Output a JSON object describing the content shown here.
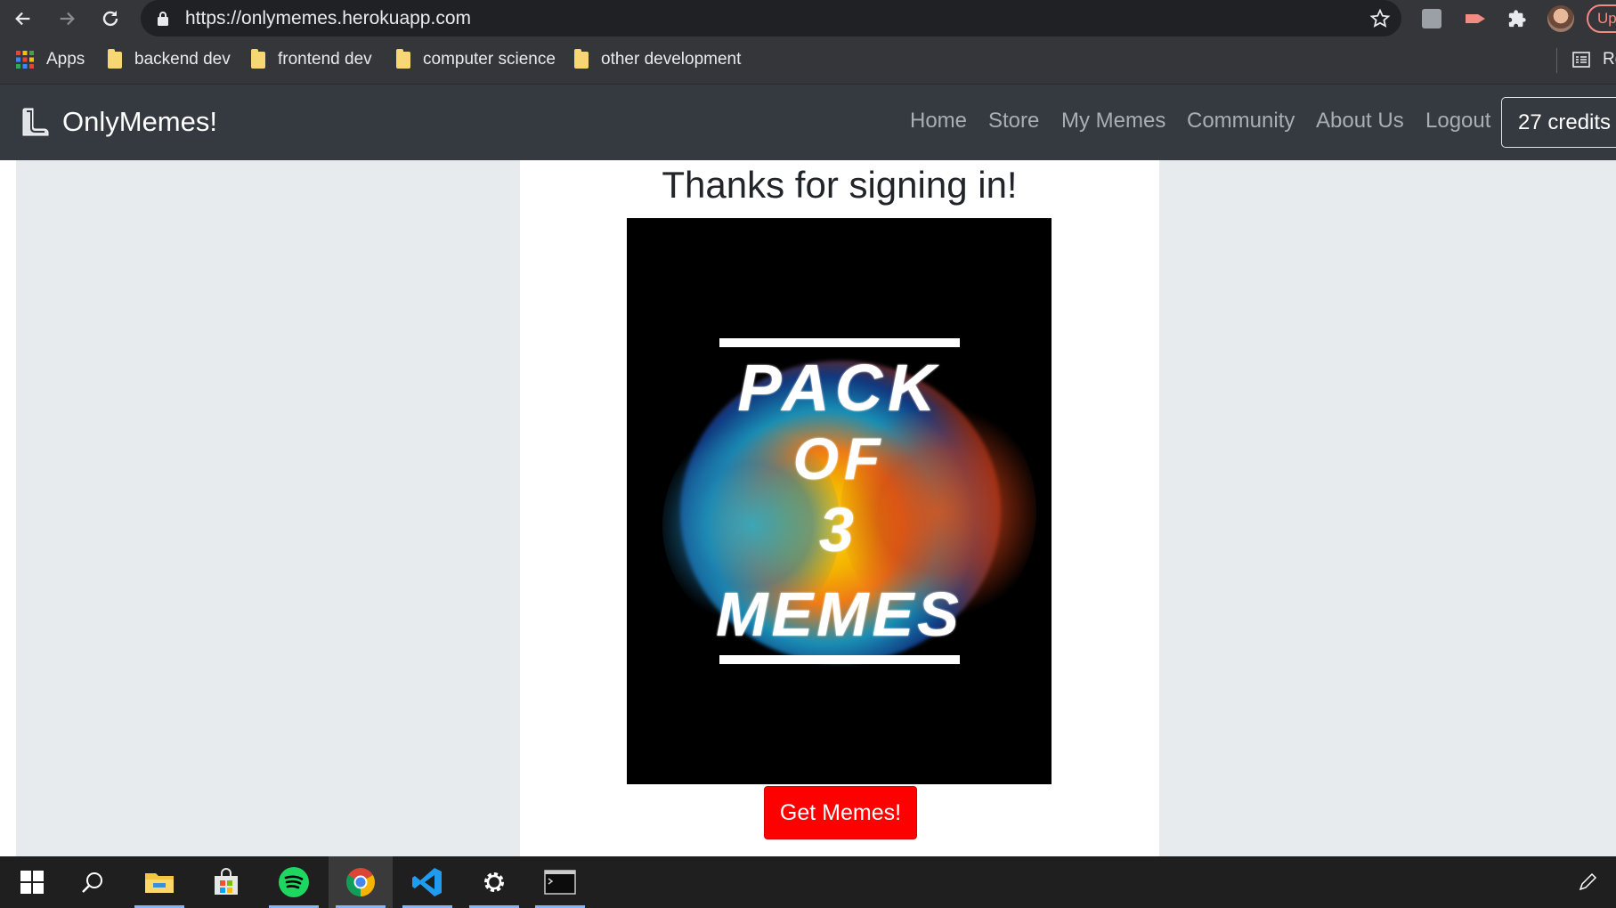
{
  "browser": {
    "url": "https://onlymemes.herokuapp.com",
    "extension_badge": "Up",
    "icons": [
      "back-icon",
      "forward-icon",
      "reload-icon",
      "lock-icon",
      "star-icon",
      "extension-icon",
      "puzzle-icon",
      "profile-avatar",
      "reading-list-icon"
    ]
  },
  "bookmarks": {
    "apps_label": "Apps",
    "items": [
      "backend dev",
      "frontend dev",
      "computer science",
      "other development"
    ],
    "reading_list_label": "Re"
  },
  "site": {
    "brand": "OnlyMemes!",
    "nav": [
      "Home",
      "Store",
      "My Memes",
      "Community",
      "About Us",
      "Logout"
    ],
    "credits": "27 credits"
  },
  "content": {
    "heading": "Thanks for signing in!",
    "poster": {
      "line1": "PACK",
      "line2": "OF",
      "line3": "3",
      "line4": "MEMES"
    },
    "button": "Get Memes!"
  },
  "taskbar": {
    "apps": [
      "start-icon",
      "search-icon",
      "file-explorer-icon",
      "store-icon",
      "spotify-icon",
      "chrome-icon",
      "vscode-icon",
      "settings-icon",
      "terminal-icon",
      "pen-icon"
    ]
  },
  "colors": {
    "chrome_bg": "#35363a",
    "navbar_bg": "#343a40",
    "cta_red": "#ff0000",
    "page_bg": "#e8ebee"
  }
}
